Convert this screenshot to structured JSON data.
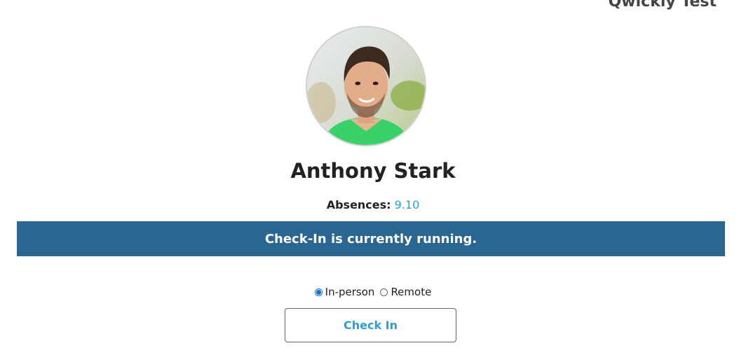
{
  "header": {
    "org_name": "Qwickly Test"
  },
  "student": {
    "avatar_icon": "student-photo",
    "name": "Anthony Stark",
    "absences_label": "Absences:",
    "absences_value": "9.10"
  },
  "status": {
    "message": "Check-In is currently running.",
    "banner_color": "#2a6690"
  },
  "attendance_mode": {
    "options": [
      {
        "label": "In-person",
        "selected": true
      },
      {
        "label": "Remote",
        "selected": false
      }
    ]
  },
  "actions": {
    "checkin_label": "Check In",
    "accent_color": "#2a9fd6"
  }
}
